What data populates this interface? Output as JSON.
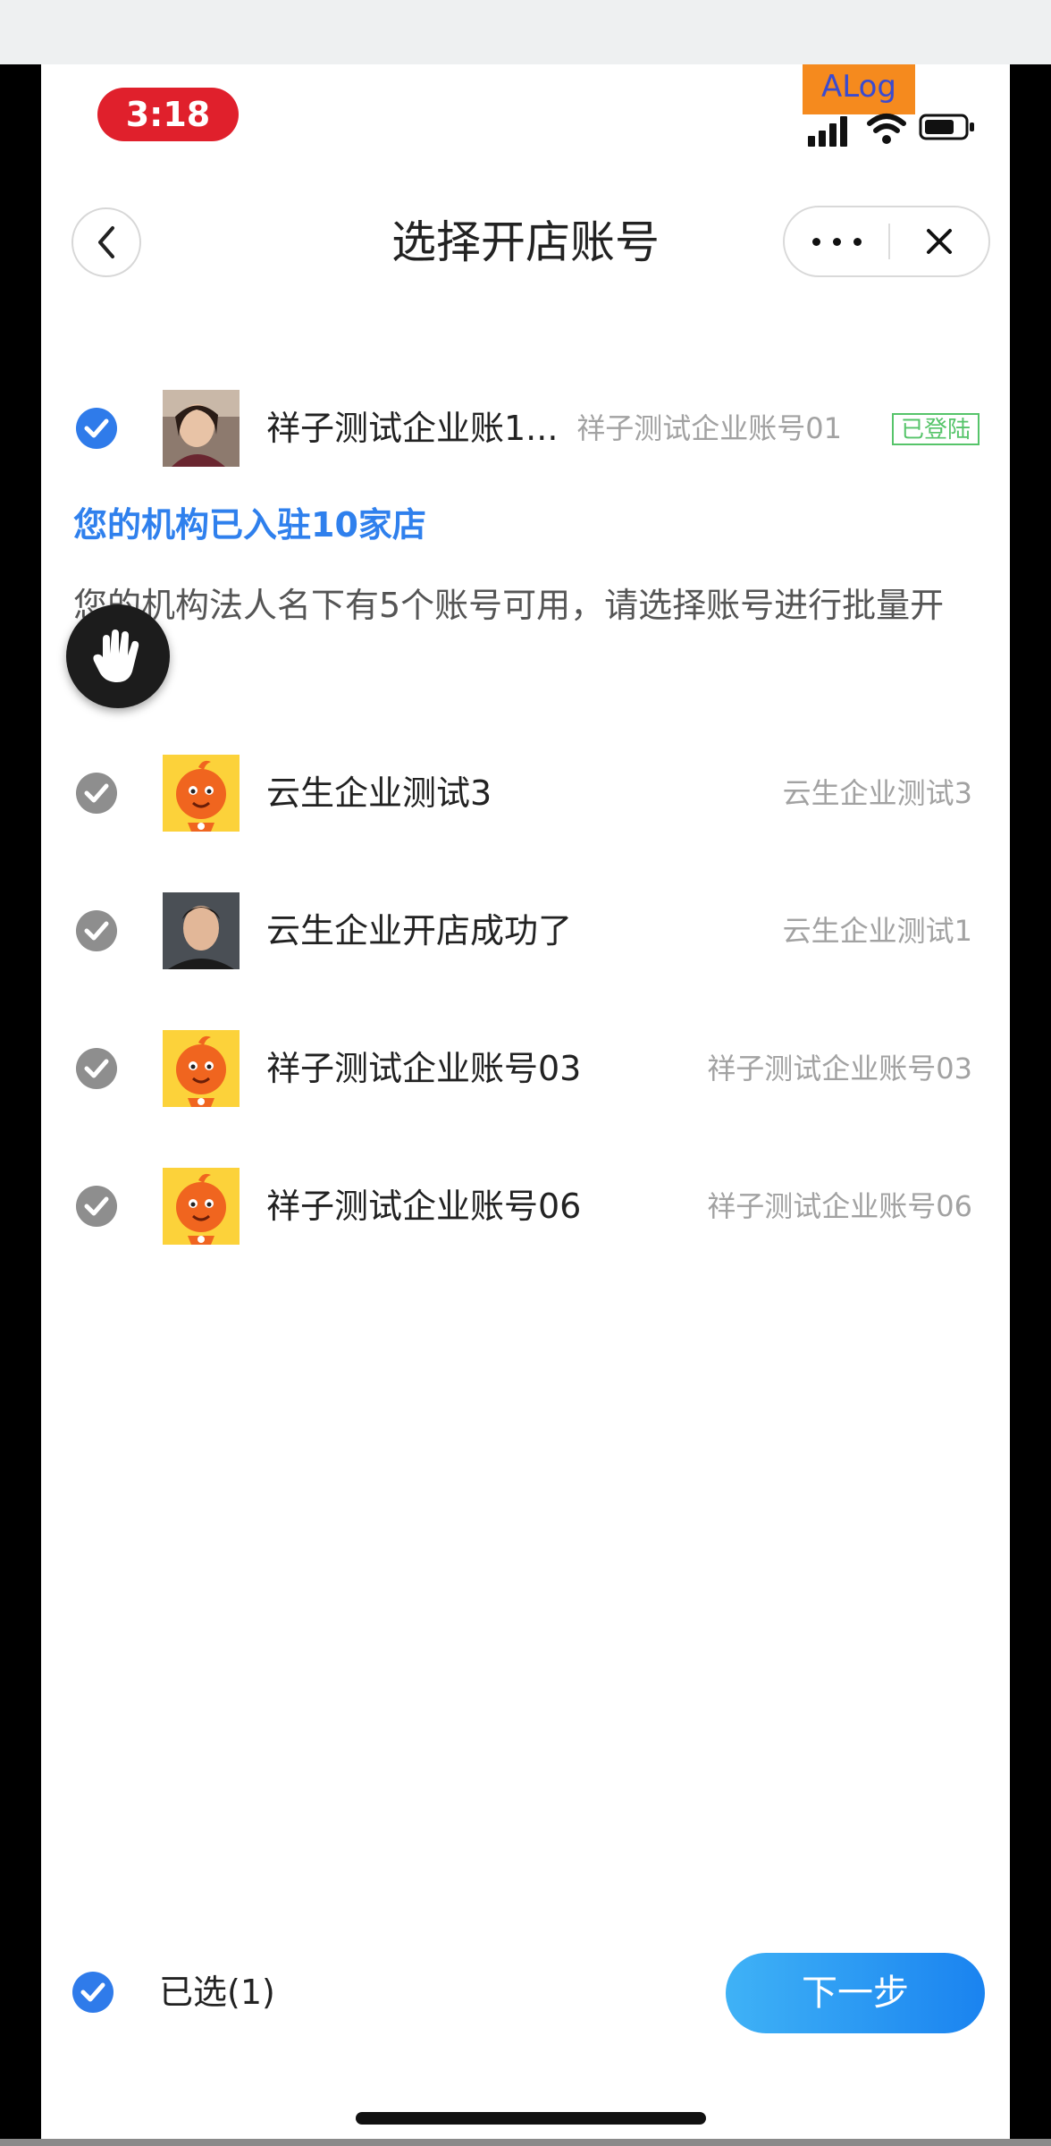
{
  "status_bar": {
    "time": "3:18",
    "debug_badge": "ALog"
  },
  "nav": {
    "title": "选择开店账号",
    "back_icon": "chevron-left-icon",
    "more_icon": "more-dots-icon",
    "close_icon": "close-icon"
  },
  "current_account": {
    "name": "祥子测试企业账1...",
    "subtitle": "祥子测试企业账号01",
    "badge": "已登陆",
    "checked": true
  },
  "notice": {
    "title": "您的机构已入驻10家店",
    "description": "您的机构法人名下有5个账号可用，请选择账号进行批量开店~"
  },
  "accounts": [
    {
      "name": "云生企业测试3",
      "subtitle": "云生企业测试3",
      "avatar": "mascot",
      "checked": false
    },
    {
      "name": "云生企业开店成功了",
      "subtitle": "云生企业测试1",
      "avatar": "photo-man",
      "checked": false
    },
    {
      "name": "祥子测试企业账号03",
      "subtitle": "祥子测试企业账号03",
      "avatar": "mascot",
      "checked": false
    },
    {
      "name": "祥子测试企业账号06",
      "subtitle": "祥子测试企业账号06",
      "avatar": "mascot",
      "checked": false
    }
  ],
  "footer": {
    "selected_label": "已选(1)",
    "next_label": "下一步"
  },
  "colors": {
    "accent": "#2f80ed",
    "check_blue": "#2f7bea",
    "check_gray": "#8e8e8e",
    "badge_green": "#56c46a",
    "button_start": "#3fb2f6",
    "button_end": "#1a83f0",
    "time_pill": "#e0202c",
    "alog_bg": "#f58a1e"
  }
}
